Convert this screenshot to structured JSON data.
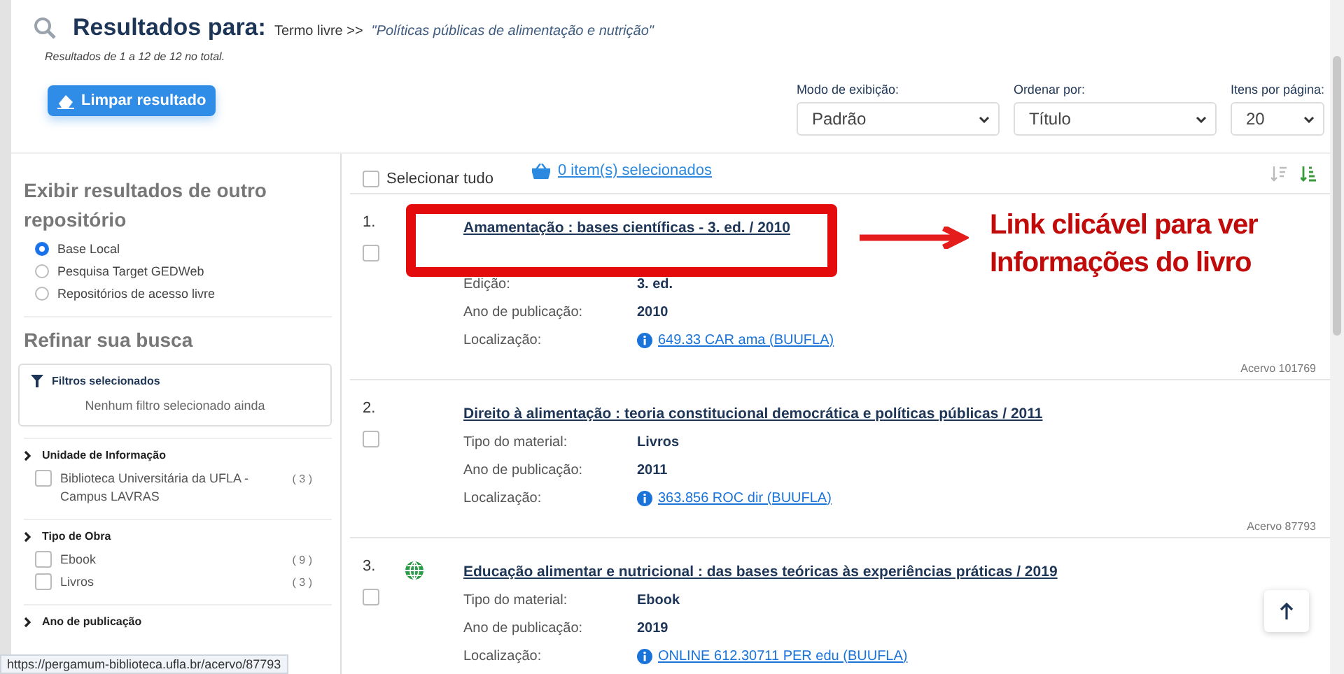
{
  "header": {
    "title": "Resultados para:",
    "term_label": "Termo livre >>",
    "term": "\"Políticas públicas de alimentação e nutrição\"",
    "count": "Resultados de 1 a 12 de 12 no total.",
    "clear_button": "Limpar resultado"
  },
  "selects": [
    {
      "label": "Modo de exibição:",
      "value": "Padrão",
      "kind": "wide"
    },
    {
      "label": "Ordenar por:",
      "value": "Título",
      "kind": "wide"
    },
    {
      "label": "Itens por página:",
      "value": "20",
      "kind": "narrow"
    }
  ],
  "sidebar": {
    "repo_heading": "Exibir resultados de outro repositório",
    "repos": [
      {
        "label": "Base Local",
        "selected": true
      },
      {
        "label": "Pesquisa Target GEDWeb",
        "selected": false
      },
      {
        "label": "Repositórios de acesso livre",
        "selected": false
      }
    ],
    "refine_heading": "Refinar sua busca",
    "filters_box": {
      "title": "Filtros selecionados",
      "empty": "Nenhum filtro selecionado ainda"
    },
    "facets": [
      {
        "title": "Unidade de Informação",
        "options": [
          {
            "label": "Biblioteca Universitária da UFLA - Campus LAVRAS",
            "count": "( 3 )",
            "checked": false
          }
        ]
      },
      {
        "title": "Tipo de Obra",
        "options": [
          {
            "label": "Ebook",
            "count": "( 9 )",
            "checked": false
          },
          {
            "label": "Livros",
            "count": "( 3 )",
            "checked": false
          }
        ]
      },
      {
        "title": "Ano de publicação"
      }
    ]
  },
  "results_toolbar": {
    "select_all": "Selecionar tudo",
    "select_all_checked": false,
    "basket": "0 item(s) selecionados"
  },
  "results": [
    {
      "number": "1.",
      "online": false,
      "title": "Amamentação : bases científicas - 3. ed. / 2010",
      "checked": false,
      "fields": [
        {
          "kind": "covered"
        },
        {
          "label": "Edição:",
          "value": "3. ed.",
          "kind": "text"
        },
        {
          "label": "Ano de publicação:",
          "value": "2010",
          "kind": "text"
        },
        {
          "label": "Localização:",
          "value": "649.33 CAR ama (BUUFLA)",
          "kind": "link"
        }
      ],
      "acervo": "Acervo 101769"
    },
    {
      "number": "2.",
      "online": false,
      "title": "Direito à alimentação : teoria constitucional democrática e políticas públicas / 2011",
      "checked": false,
      "fields": [
        {
          "label": "Tipo do material:",
          "value": "Livros",
          "kind": "text"
        },
        {
          "label": "Ano de publicação:",
          "value": "2011",
          "kind": "text"
        },
        {
          "label": "Localização:",
          "value": "363.856 ROC dir (BUUFLA)",
          "kind": "link"
        }
      ],
      "acervo": "Acervo 87793"
    },
    {
      "number": "3.",
      "online": true,
      "title": "Educação alimentar e nutricional : das bases teóricas às experiências práticas / 2019",
      "checked": false,
      "fields": [
        {
          "label": "Tipo do material:",
          "value": "Ebook",
          "kind": "text"
        },
        {
          "label": "Ano de publicação:",
          "value": "2019",
          "kind": "text"
        },
        {
          "label": "Localização:",
          "value": "ONLINE 612.30711 PER edu (BUUFLA)",
          "kind": "link"
        }
      ]
    }
  ],
  "annotation": {
    "lines": [
      "Link clicável para ver",
      "Informações do livro"
    ]
  },
  "status_url": "https://pergamum-biblioteca.ufla.br/acervo/87793"
}
